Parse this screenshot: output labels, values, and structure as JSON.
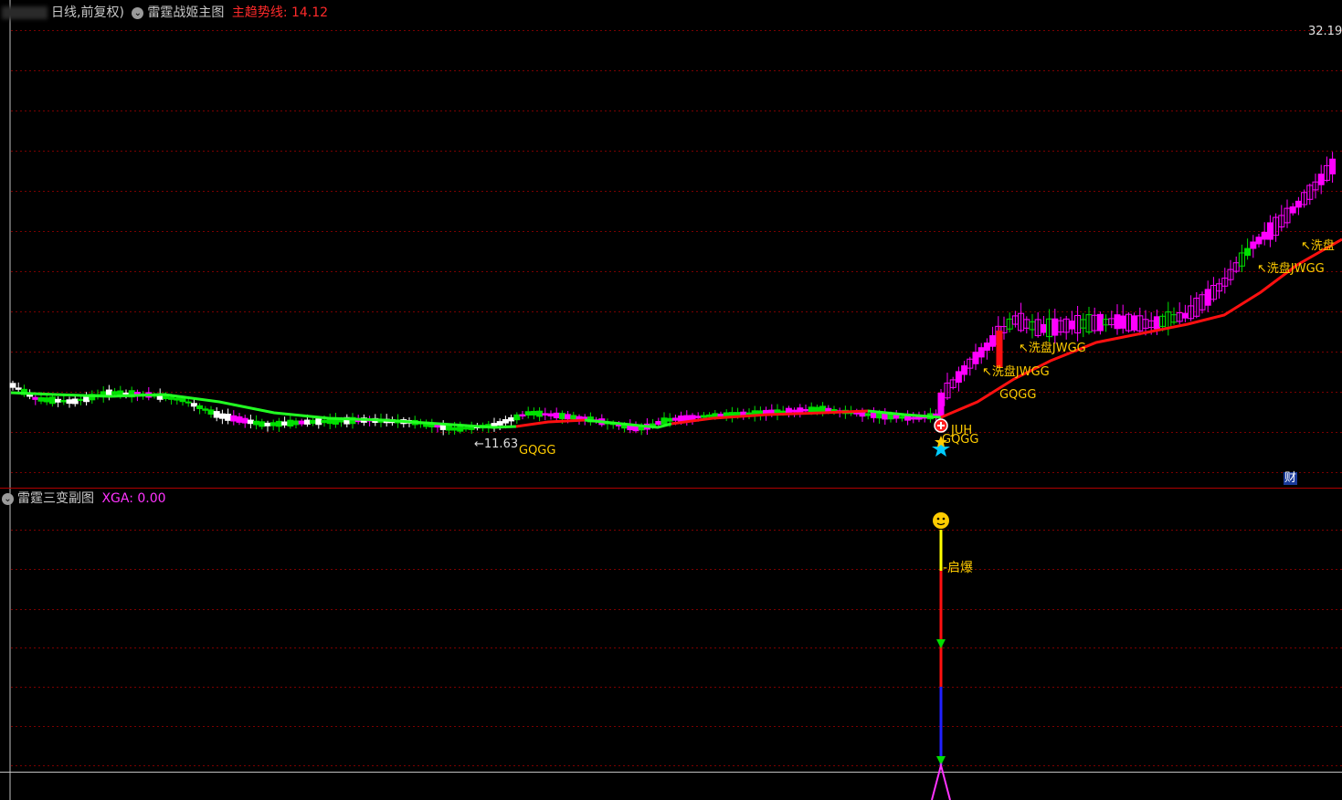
{
  "main_panel": {
    "period_label": "日线,前复权)",
    "indicator_name": "雷霆战姬主图",
    "trend_label": "主趋势线: 14.12",
    "price_high": "32.19",
    "low_price_marker": "←11.63",
    "cai_badge": "财",
    "annotations": {
      "gqgg_1": "GQGG",
      "gqgg_2": "GQGG",
      "gqgg_3": "GQGG",
      "juh": "JUH",
      "wash_1": "↖洗盘JWGG",
      "wash_2": "↖洗盘JWGG",
      "wash_3": "↖洗盘JWGG",
      "wash_4": "↖洗盘"
    }
  },
  "sub_panel": {
    "indicator_name": "雷霆三变副图",
    "xga_label": "XGA: 0.00",
    "signal_label": "-启爆"
  },
  "colors": {
    "background": "#000000",
    "grid": "#7a0000",
    "bull": "#ff00ff",
    "bear": "#00e000",
    "trend_up": "#ff1010",
    "trend_down": "#22ff22",
    "annotation": "#ffcc00"
  }
}
